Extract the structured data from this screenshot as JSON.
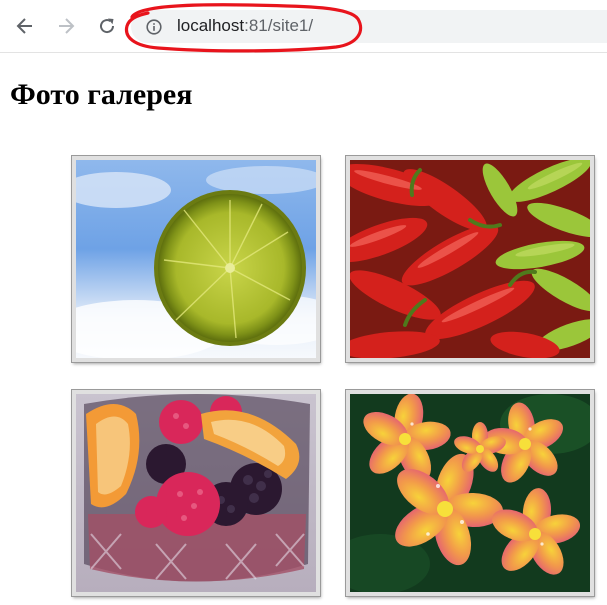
{
  "browser": {
    "back_icon": "arrow-left-icon",
    "forward_icon": "arrow-right-icon",
    "reload_icon": "reload-icon",
    "info_icon": "info-icon",
    "url_host": "localhost",
    "url_path": ":81/site1/",
    "annotation_color": "#e8141c"
  },
  "page": {
    "title": "Фото галерея"
  },
  "gallery": {
    "images": [
      {
        "name": "photo-lime"
      },
      {
        "name": "photo-peppers"
      },
      {
        "name": "photo-fruit-glass"
      },
      {
        "name": "photo-plumeria-flowers"
      }
    ]
  }
}
